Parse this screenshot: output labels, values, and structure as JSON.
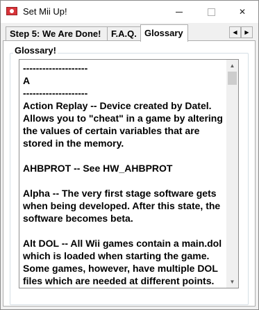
{
  "window": {
    "title": "Set Mii Up!",
    "icon": "app-icon",
    "controls": {
      "minimize_icon": "minimize-icon",
      "maximize_icon": "maximize-icon",
      "close_glyph": "✕"
    }
  },
  "tabs": [
    {
      "label": "Step 5: We Are Done!",
      "active": false
    },
    {
      "label": "F.A.Q.",
      "active": false
    },
    {
      "label": "Glossary",
      "active": true
    }
  ],
  "tab_scroll": {
    "left": "◀",
    "right": "▶"
  },
  "group": {
    "label": "Glossary!"
  },
  "glossary_text": "--------------------\nA\n--------------------\nAction Replay -- Device created by Datel. Allows you to \"cheat\" in a game by altering the values of certain variables that are stored in the memory.\n\nAHBPROT -- See HW_AHBPROT\n\nAlpha -- The very first stage software gets when being developed. After this state, the software becomes beta.\n\nAlt DOL -- All Wii games contain a main.dol which is loaded when starting the game. Some games, however, have multiple DOL files which are needed at different points. These are referred to as alternate DOLs. The method used for loading them is also called",
  "scrollbar": {
    "up": "▲",
    "down": "▼",
    "position": 0
  }
}
